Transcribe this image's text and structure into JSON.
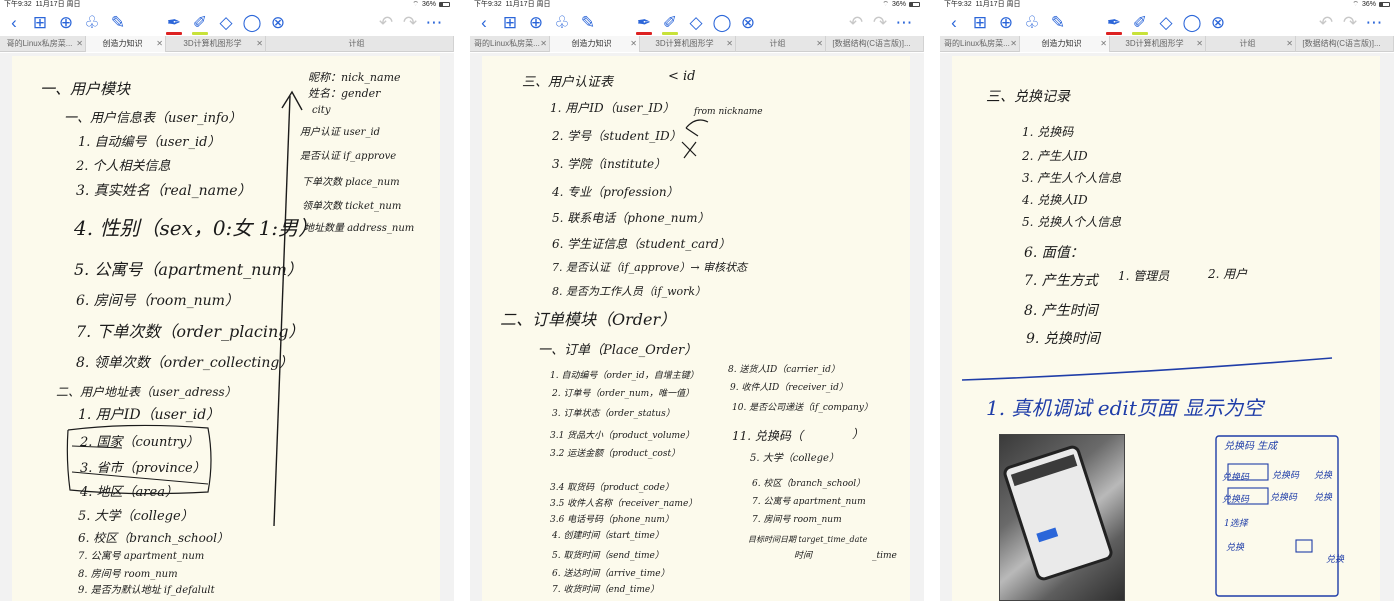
{
  "panels": [
    {
      "status": {
        "time": "下午9:32",
        "date": "11月17日 周日",
        "battery": "36%"
      },
      "tabs": [
        "哥的Linux私房菜...",
        "创造力知识",
        "3D计算机图形学",
        "计组"
      ],
      "active_tab": 1,
      "lines": [
        "一、用户模块",
        "一、用户信息表（user_info）",
        "1. 自动编号（user_id）",
        "2. 个人相关信息",
        "3. 真实姓名（real_name）",
        "4. 性别（sex，0:女 1:男）",
        "5. 公寓号（apartment_num）",
        "6. 房间号（room_num）",
        "7. 下单次数（order_placing）",
        "8. 领单次数（order_collecting）",
        "二、用户地址表（user_adress）",
        "1. 用户ID（user_id）",
        "2. 国家（country）",
        "3. 省市（province）",
        "4. 地区（area）",
        "5. 大学（college）",
        "6. 校区（branch_school）",
        "7. 公寓号 apartment_num",
        "8. 房间号 room_num",
        "9. 是否为默认地址 if_defalult",
        "昵称：nick_name",
        "姓名：gender",
        "city",
        "用户认证 user_id",
        "是否认证 if_approve",
        "下单次数 place_num",
        "领单次数 ticket_num",
        "地址数量 address_num"
      ]
    },
    {
      "status": {
        "time": "下午9:32",
        "date": "11月17日 周日",
        "battery": "36%"
      },
      "tabs": [
        "哥的Linux私房菜...",
        "创造力知识",
        "3D计算机图形学",
        "计组",
        "[数据结构(C语言版)]..."
      ],
      "active_tab": 1,
      "lines": [
        "三、用户认证表",
        "< id",
        "1. 用户ID（user_ID）",
        "2. 学号（student_ID）",
        "3. 学院（institute）",
        "4. 专业（profession）",
        "5. 联系电话（phone_num）",
        "6. 学生证信息（student_card）",
        "7. 是否认证（if_approve）→ 审核状态",
        "8. 是否为工作人员（if_work）",
        "from nickname",
        "二、订单模块（Order）",
        "一、订单（Place_Order）",
        "1. 自动编号（order_id，自增主键）",
        "2. 订单号（order_num，唯一值）",
        "3. 订单状态（order_status）",
        "3.1 货品大小（product_volume）",
        "3.2 运送金额（product_cost）",
        "3.4 取货码（product_code）",
        "3.5 收件人名称（receiver_name）",
        "3.6 电话号码（phone_num）",
        "4. 创建时间（start_time）",
        "5. 取货时间（send_time）",
        "6. 送达时间（arrive_time）",
        "7. 收货时间（end_time）",
        "8. 送货人ID（carrier_id）",
        "9. 收件人ID（receiver_id）",
        "10. 是否公司递送（if_company）",
        "11. 兑换码（",
        "）",
        "5. 大学（college）",
        "6. 校区（branch_school）",
        "7. 公寓号 apartment_num",
        "7. 房间号 room_num",
        "目标时间日期 target_time_date",
        "时间",
        "_time"
      ]
    },
    {
      "status": {
        "time": "下午9:32",
        "date": "11月17日 周日",
        "battery": "36%"
      },
      "tabs": [
        "哥的Linux私房菜...",
        "创造力知识",
        "3D计算机图形学",
        "计组",
        "[数据结构(C语言版)]..."
      ],
      "active_tab": 1,
      "lines": [
        "三、兑换记录",
        "1. 兑换码",
        "2. 产生人ID",
        "3. 产生人个人信息",
        "4. 兑换人ID",
        "5. 兑换人个人信息",
        "6. 面值：",
        "7. 产生方式",
        "1. 管理员",
        "2. 用户",
        "8. 产生时间",
        "9. 兑换时间",
        "1. 真机调试 edit页面 显示为空",
        "兑换码 生成",
        "兑换码",
        "兑换码",
        "兑换码",
        "兑换码",
        "兑换",
        "兑换",
        "1选择",
        "兑换",
        "兑换"
      ]
    }
  ]
}
